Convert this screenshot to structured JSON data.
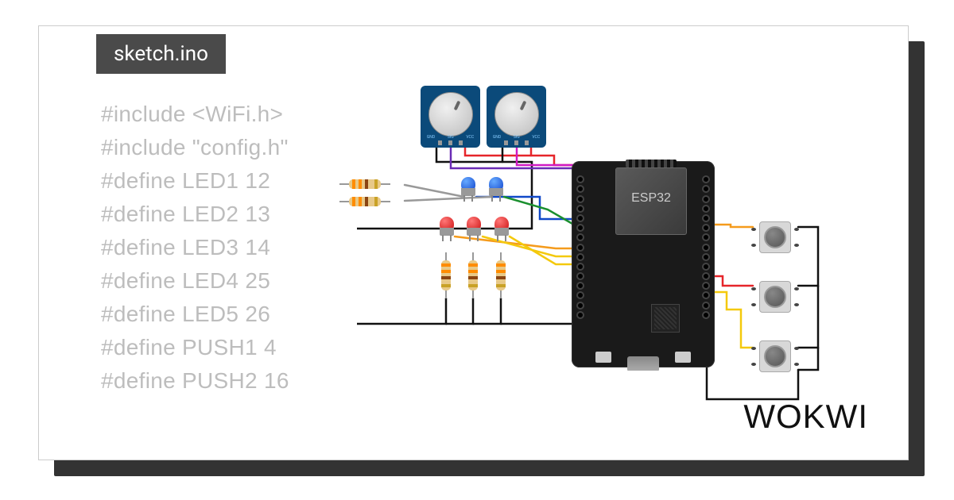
{
  "tab": {
    "filename": "sketch.ino"
  },
  "code": {
    "lines": [
      "#include <WiFi.h>",
      "#include \"config.h\"",
      "",
      "#define LED1 12",
      "#define LED2 13",
      "#define LED3 14",
      "#define LED4 25",
      "#define LED5 26",
      "#define PUSH1 4",
      "#define PUSH2 16"
    ]
  },
  "logo": {
    "text": "WOKWI"
  },
  "components": {
    "board": {
      "name": "ESP32",
      "label": "ESP32"
    },
    "potentiometers": [
      {
        "id": "pot1",
        "pins": [
          "GND",
          "SIG",
          "VCC"
        ]
      },
      {
        "id": "pot2",
        "pins": [
          "GND",
          "SIG",
          "VCC"
        ]
      }
    ],
    "leds": [
      {
        "id": "led-blue-1",
        "color": "blue"
      },
      {
        "id": "led-blue-2",
        "color": "blue"
      },
      {
        "id": "led-red-1",
        "color": "red"
      },
      {
        "id": "led-red-2",
        "color": "red"
      },
      {
        "id": "led-red-3",
        "color": "red"
      }
    ],
    "resistors": [
      {
        "id": "r-h1",
        "orientation": "horizontal"
      },
      {
        "id": "r-h2",
        "orientation": "horizontal"
      },
      {
        "id": "r-v1",
        "orientation": "vertical"
      },
      {
        "id": "r-v2",
        "orientation": "vertical"
      },
      {
        "id": "r-v3",
        "orientation": "vertical"
      }
    ],
    "pushbuttons": [
      {
        "id": "push1"
      },
      {
        "id": "push2"
      },
      {
        "id": "push3"
      }
    ]
  },
  "wire_colors": {
    "red": "#e6252a",
    "black": "#111",
    "green": "#1a8f2e",
    "blue": "#1048c8",
    "orange": "#f59b1c",
    "yellow": "#f4c90c",
    "magenta": "#d11bc4",
    "purple": "#6a2bb5"
  }
}
